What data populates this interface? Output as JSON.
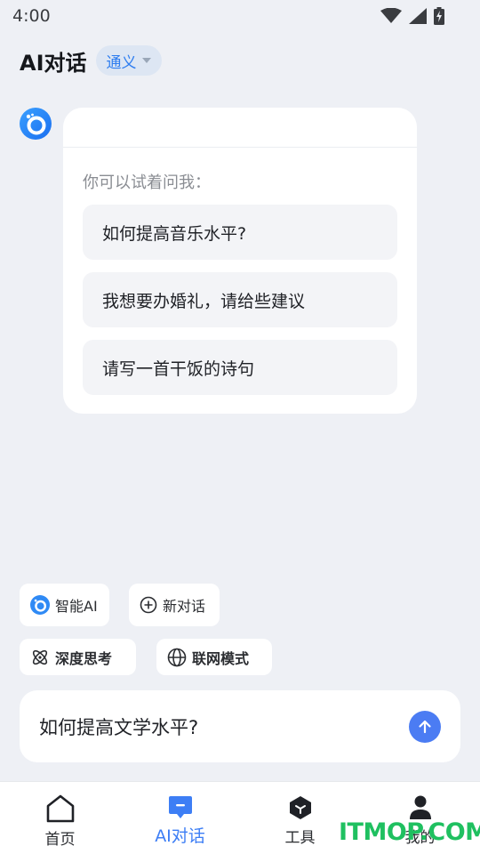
{
  "status_bar": {
    "time": "4:00",
    "icons": [
      "wifi-icon",
      "signal-icon",
      "battery-charging-icon"
    ]
  },
  "header": {
    "title": "AI对话",
    "model_label": "通义"
  },
  "message": {
    "avatar_icon": "bot-logo-icon",
    "hint": "你可以试着问我：",
    "suggestions": [
      "如何提高音乐水平?",
      "我想要办婚礼，请给些建议",
      "请写一首干饭的诗句"
    ]
  },
  "chips": {
    "smart_ai": "智能AI",
    "new_chat": "新对话",
    "deep_think": "深度思考",
    "web_mode": "联网模式"
  },
  "input": {
    "value": "如何提高文学水平?",
    "send_icon": "arrow-up-icon"
  },
  "bottom_nav": {
    "items": [
      {
        "label": "首页",
        "icon": "home-icon"
      },
      {
        "label": "AI对话",
        "icon": "chat-bubble-icon",
        "active": true
      },
      {
        "label": "工具",
        "icon": "cube-icon"
      },
      {
        "label": "我的",
        "icon": "person-icon"
      }
    ]
  },
  "watermark": "ITMOP.COM",
  "colors": {
    "accent": "#3d7ef5",
    "send": "#4b7cf3",
    "background": "#eef0f5",
    "watermark": "#1fc060"
  }
}
